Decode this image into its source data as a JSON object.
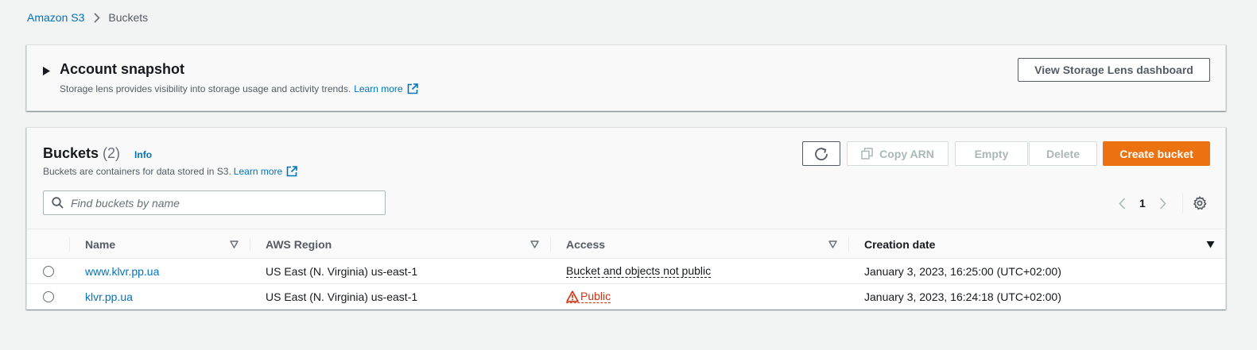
{
  "breadcrumb": {
    "root": "Amazon S3",
    "current": "Buckets"
  },
  "snapshot": {
    "title": "Account snapshot",
    "description": "Storage lens provides visibility into storage usage and activity trends.",
    "learn_more": "Learn more",
    "dashboard_button": "View Storage Lens dashboard"
  },
  "buckets": {
    "title": "Buckets",
    "count": "(2)",
    "info": "Info",
    "description": "Buckets are containers for data stored in S3.",
    "learn_more": "Learn more",
    "toolbar": {
      "copy_arn": "Copy ARN",
      "empty": "Empty",
      "delete": "Delete",
      "create": "Create bucket"
    },
    "search": {
      "placeholder": "Find buckets by name",
      "value": ""
    },
    "pagination": {
      "page": "1"
    },
    "columns": {
      "name": "Name",
      "region": "AWS Region",
      "access": "Access",
      "created": "Creation date"
    },
    "rows": [
      {
        "name": "www.klvr.pp.ua",
        "region": "US East (N. Virginia) us-east-1",
        "access": "Bucket and objects not public",
        "created": "January 3, 2023, 16:25:00 (UTC+02:00)"
      },
      {
        "name": "klvr.pp.ua",
        "region": "US East (N. Virginia) us-east-1",
        "access": "Public",
        "created": "January 3, 2023, 16:24:18 (UTC+02:00)"
      }
    ]
  },
  "colors": {
    "link": "#0073bb",
    "primary": "#ec7211",
    "danger": "#d13212",
    "background": "#f2f3f3"
  }
}
